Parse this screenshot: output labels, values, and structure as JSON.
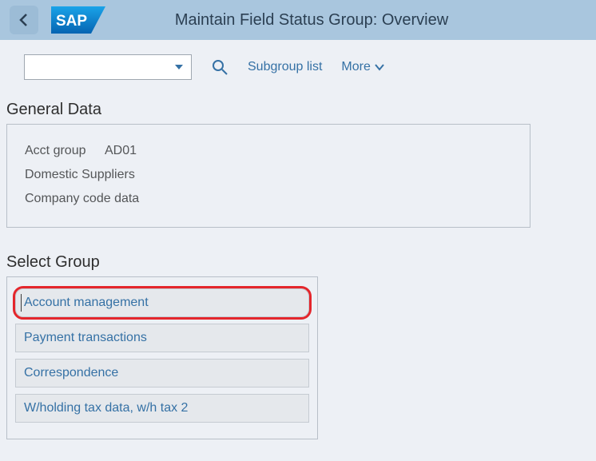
{
  "header": {
    "title": "Maintain Field Status Group: Overview"
  },
  "toolbar": {
    "subgroup_label": "Subgroup list",
    "more_label": "More"
  },
  "general": {
    "heading": "General Data",
    "acct_group_label": "Acct group",
    "acct_group_value": "AD01",
    "description": "Domestic Suppliers",
    "subobject": "Company code data"
  },
  "select": {
    "heading": "Select Group",
    "groups": [
      "Account management",
      "Payment transactions",
      "Correspondence",
      "W/holding tax data, w/h tax 2"
    ]
  }
}
